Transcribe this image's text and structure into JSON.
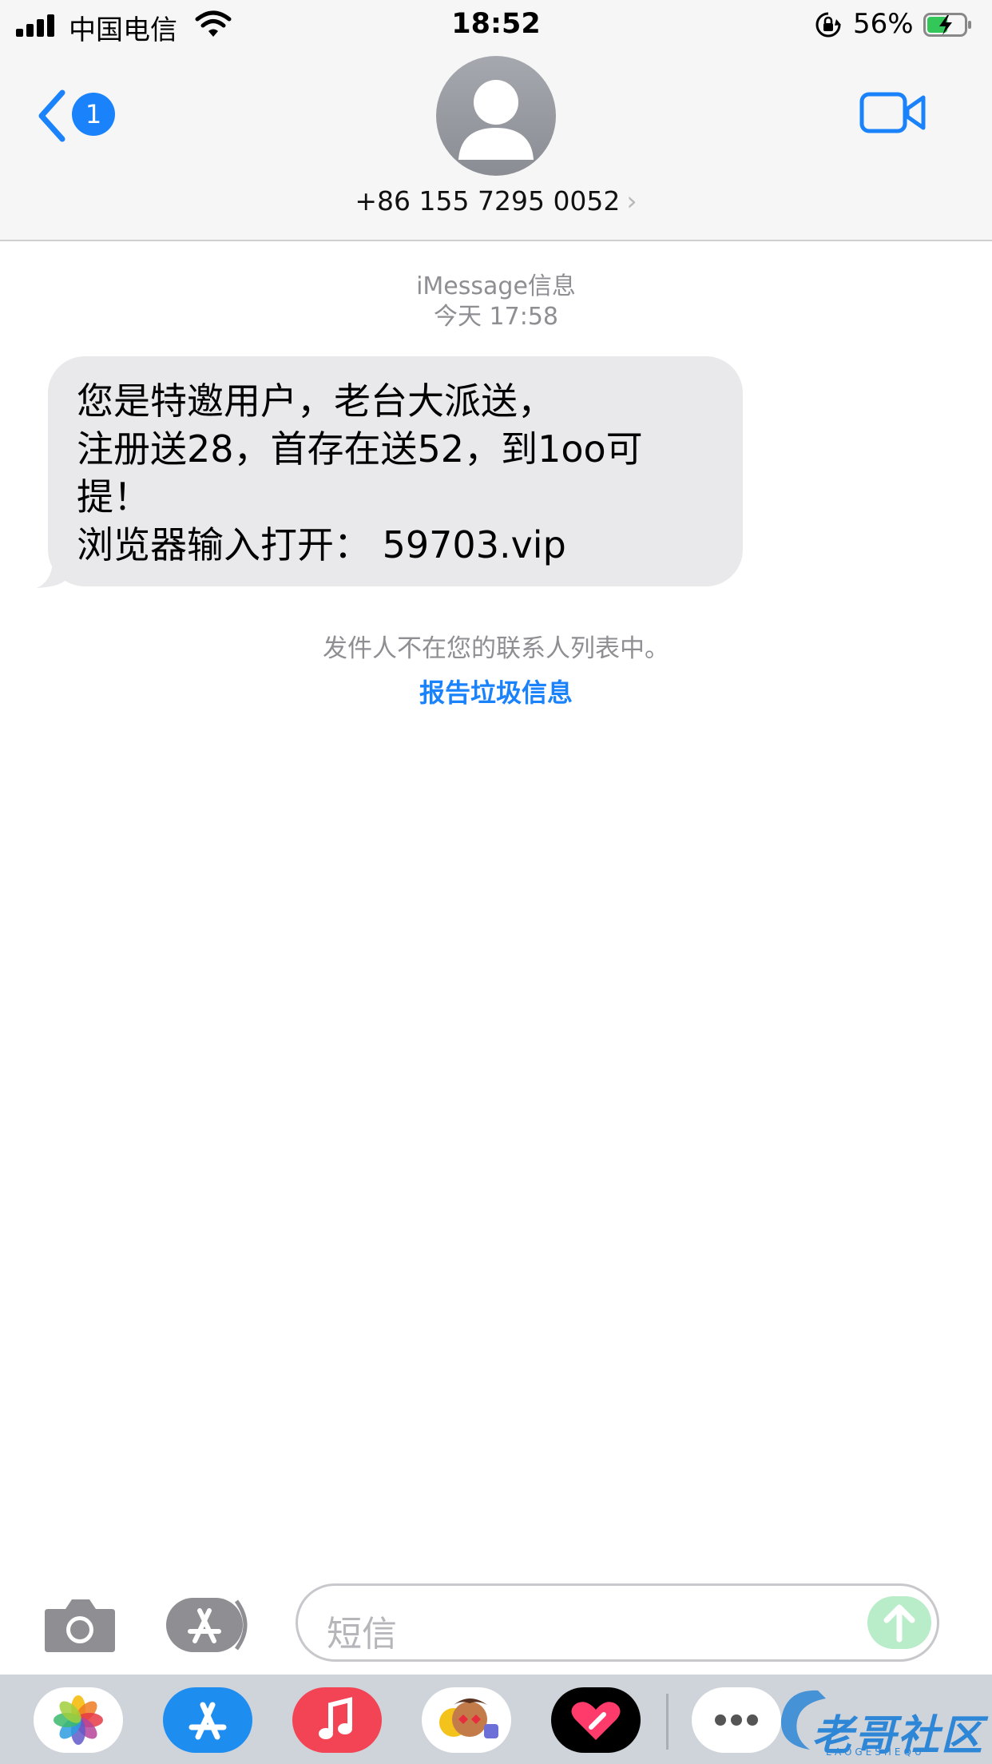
{
  "status_bar": {
    "carrier": "中国电信",
    "time": "18:52",
    "battery_percent": "56%",
    "battery_level": 0.56,
    "icons": [
      "signal-icon",
      "wifi-icon",
      "orientation-lock-icon",
      "battery-charging-icon"
    ]
  },
  "nav": {
    "back_badge": "1",
    "contact": "+86 155 7295 0052",
    "chevron": "›",
    "icons": [
      "back-chevron-icon",
      "avatar-icon",
      "video-call-icon"
    ]
  },
  "thread": {
    "service": "iMessage信息",
    "timestamp": "今天 17:58",
    "message": "您是特邀用户，老台大派送，\n注册送28，首存在送52，到1oo可\n提！\n浏览器输入打开：  59703.vip",
    "notice": "发件人不在您的联系人列表中。",
    "report_link": "报告垃圾信息"
  },
  "compose": {
    "placeholder": "短信",
    "icons": [
      "camera-icon",
      "app-store-icon",
      "send-arrow-icon"
    ]
  },
  "drawer": {
    "apps": [
      "photos-icon",
      "app-store-icon",
      "music-icon",
      "memoji-icon",
      "digital-touch-icon",
      "more-icon"
    ]
  },
  "watermark": {
    "title": "老哥社区",
    "subtitle": "LAOGESHEQU"
  },
  "colors": {
    "accent": "#1a82fb",
    "bubble": "#e9e9eb",
    "header_bg": "#f6f6f6",
    "drawer_bg": "#cfd3da"
  }
}
